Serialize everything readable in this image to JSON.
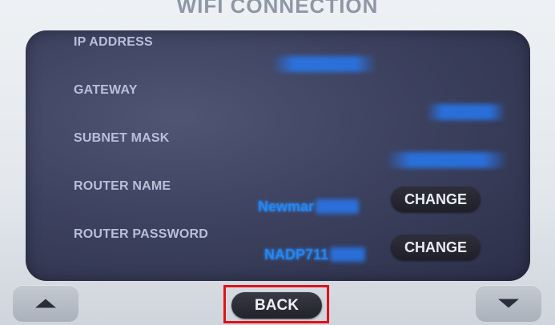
{
  "screen": {
    "title": "WIFI CONNECTION"
  },
  "fields": {
    "ip_address": {
      "label": "IP ADDRESS"
    },
    "gateway": {
      "label": "GATEWAY"
    },
    "subnet_mask": {
      "label": "SUBNET MASK"
    },
    "router_name": {
      "label": "ROUTER NAME",
      "value_visible": "Newmar"
    },
    "router_password": {
      "label": "ROUTER PASSWORD",
      "value_visible": "NADP711"
    }
  },
  "buttons": {
    "change_router_name": "CHANGE",
    "change_router_password": "CHANGE",
    "back": "BACK",
    "scroll_up_icon": "up-triangle",
    "scroll_down_icon": "down-triangle"
  },
  "colors": {
    "panel": "#3d4260",
    "label_text": "#b8c0d8",
    "value_text": "#1e8bff",
    "highlight_frame": "#e0121a"
  }
}
